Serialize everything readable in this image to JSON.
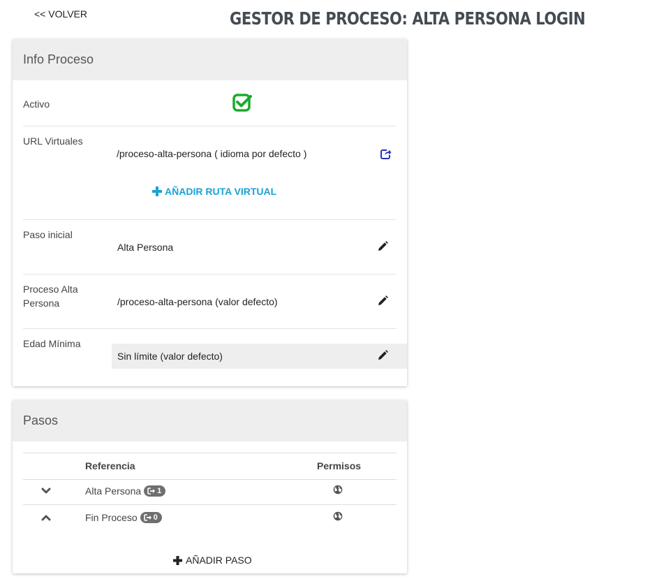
{
  "nav": {
    "back_label": "<< VOLVER"
  },
  "page": {
    "title": "GESTOR DE PROCESO: ALTA PERSONA LOGIN"
  },
  "info_card": {
    "title": "Info Proceso",
    "activo": {
      "label": "Activo",
      "checked": true,
      "icon": "checkbox-checked-icon",
      "color": "#1aab2d"
    },
    "urls": {
      "label": "URL Virtuales",
      "items": [
        {
          "value": "/proceso-alta-persona ( idioma por defecto )",
          "icon": "external-link-icon"
        }
      ],
      "add_label": "AÑADIR RUTA VIRTUAL"
    },
    "paso_inicial": {
      "label": "Paso inicial",
      "value": "Alta Persona",
      "icon": "pencil-icon"
    },
    "proceso_alta": {
      "label": "Proceso Alta Persona",
      "value": "/proceso-alta-persona (valor defecto)",
      "icon": "pencil-icon"
    },
    "edad_minima": {
      "label": "Edad Mínima",
      "value": "Sin límite (valor defecto)",
      "icon": "pencil-icon"
    }
  },
  "pasos_card": {
    "title": "Pasos",
    "columns": {
      "referencia": "Referencia",
      "permisos": "Permisos"
    },
    "rows": [
      {
        "chevron": "chevron-down-icon",
        "name": "Alta Persona",
        "badge_count": "1",
        "permission_icon": "globe-icon"
      },
      {
        "chevron": "chevron-up-icon",
        "name": "Fin Proceso",
        "badge_count": "0",
        "permission_icon": "globe-icon"
      }
    ],
    "add_label": "AÑADIR PASO"
  },
  "colors": {
    "accent_blue": "#1aa2d4",
    "link_icon_blue": "#2233bb",
    "success_green": "#1aab2d",
    "header_bg": "#eeeeee"
  }
}
